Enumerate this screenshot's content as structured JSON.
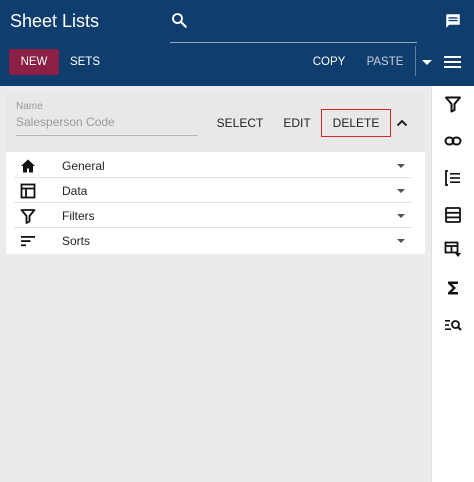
{
  "header": {
    "title": "Sheet Lists",
    "search_icon": "search-icon",
    "chat_icon": "chat-icon"
  },
  "toolbar": {
    "new_label": "NEW",
    "sets_label": "SETS",
    "copy_label": "COPY",
    "paste_label": "PASTE",
    "dropdown_icon": "caret-down-icon",
    "menu_icon": "menu-icon"
  },
  "list_panel": {
    "name_label": "Name",
    "name_value": "Salesperson Code",
    "select_label": "SELECT",
    "edit_label": "EDIT",
    "delete_label": "DELETE",
    "collapse_icon": "chevron-up-icon",
    "sections": [
      {
        "label": "General",
        "icon": "home-icon"
      },
      {
        "label": "Data",
        "icon": "table-icon"
      },
      {
        "label": "Filters",
        "icon": "filter-icon"
      },
      {
        "label": "Sorts",
        "icon": "sort-icon"
      }
    ]
  },
  "right_toolbar": {
    "icons": [
      "filter-icon",
      "link-icon",
      "list-bracket-icon",
      "rows-icon",
      "table-filter-icon",
      "sigma-icon",
      "list-search-icon"
    ]
  },
  "colors": {
    "header_bg": "#0e3d6e",
    "new_button_bg": "#8b1f45",
    "delete_highlight": "#d7262b",
    "workspace_bg": "#edebe9"
  }
}
